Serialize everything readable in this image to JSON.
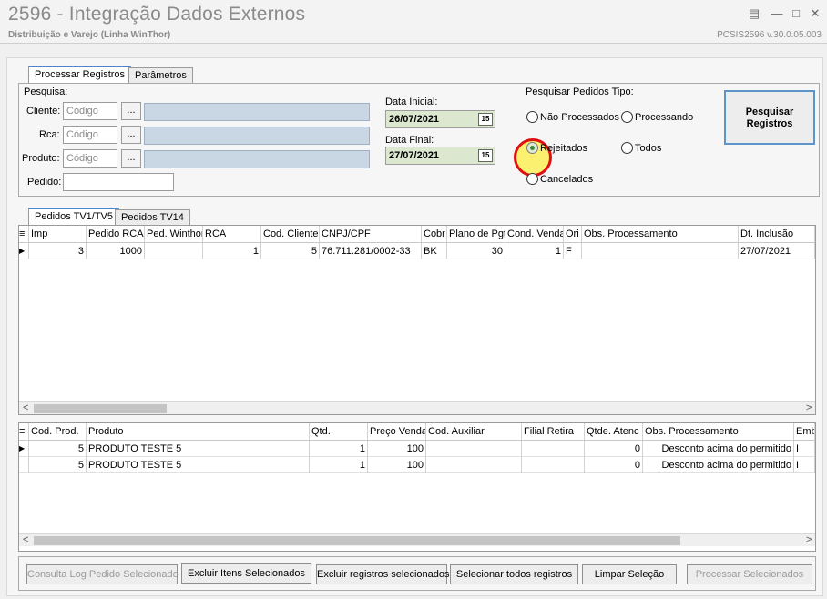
{
  "window": {
    "title": "2596 - Integração Dados Externos",
    "subtitle": "Distribuição e Varejo (Linha WinThor)",
    "version": "PCSIS2596  v.30.0.05.003"
  },
  "tabs_top": [
    "Processar Registros",
    "Parâmetros"
  ],
  "search": {
    "group_label": "Pesquisa:",
    "cliente_label": "Cliente:",
    "rca_label": "Rca:",
    "produto_label": "Produto:",
    "pedido_label": "Pedido:",
    "code_placeholder": "Código",
    "dots_label": "...",
    "data_inicial_label": "Data Inicial:",
    "data_inicial": "26/07/2021",
    "data_final_label": "Data Final:",
    "data_final": "27/07/2021"
  },
  "order_type": {
    "group_label": "Pesquisar Pedidos Tipo:",
    "options": [
      "Não Processados",
      "Processando",
      "Rejeitados",
      "Todos",
      "Cancelados"
    ],
    "selected": "Rejeitados"
  },
  "search_button": "Pesquisar Registros",
  "tabs_mid": [
    "Pedidos TV1/TV5",
    "Pedidos TV14"
  ],
  "orders_grid": {
    "columns": [
      "Imp",
      "Pedido RCA",
      "Ped. Winthor",
      "RCA",
      "Cod. Cliente",
      "CNPJ/CPF",
      "Cobr",
      "Plano de Pgt",
      "Cond. Venda",
      "Ori",
      "Obs. Processamento",
      "Dt. Inclusão"
    ],
    "rows": [
      [
        "3",
        "1000",
        "",
        "1",
        "5",
        "76.711.281/0002-33",
        "BK",
        "30",
        "1",
        "F",
        "",
        "27/07/2021"
      ]
    ]
  },
  "items_grid": {
    "columns": [
      "Cod. Prod.",
      "Produto",
      "Qtd.",
      "Preço Venda",
      "Cod. Auxiliar",
      "Filial Retira",
      "Qtde. Atenc",
      "Obs. Processamento",
      "Emb."
    ],
    "rows": [
      [
        "5",
        "PRODUTO TESTE 5",
        "1",
        "100",
        "",
        "",
        "0",
        "Desconto acima do permitido",
        "I"
      ],
      [
        "5",
        "PRODUTO TESTE 5",
        "1",
        "100",
        "",
        "",
        "0",
        "Desconto acima do permitido",
        "I"
      ]
    ]
  },
  "actions": {
    "consulta_log": "Consulta Log Pedido Selecionado",
    "excluir_itens": "Excluir Itens Selecionados",
    "excluir_registros": "Excluir registros selecionados",
    "selecionar_todos": "Selecionar todos registros",
    "limpar": "Limpar Seleção",
    "processar": "Processar Selecionados"
  }
}
